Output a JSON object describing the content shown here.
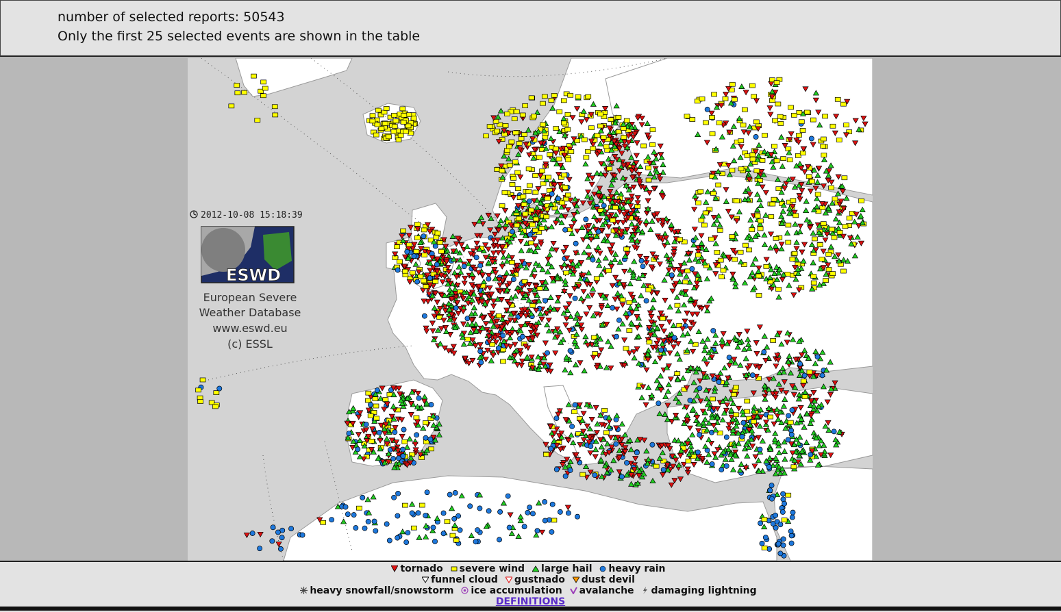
{
  "info": {
    "line1": "number of selected reports: 50543",
    "line2": "Only the first 25 selected events are shown in the table"
  },
  "map": {
    "timestamp": "2012-10-08 15:18:39",
    "logo_text": "ESWD",
    "caption": [
      "European Severe",
      "Weather Database",
      "www.eswd.eu",
      "(c) ESSL"
    ],
    "colors": {
      "sea": "#d3d3d3",
      "land": "#ffffff",
      "tornado": "#dd1111",
      "severe_wind": "#ffff00",
      "large_hail": "#22cc22",
      "heavy_rain": "#1e78dc"
    }
  },
  "legend": {
    "tornado": "tornado",
    "severe_wind": "severe wind",
    "large_hail": "large hail",
    "heavy_rain": "heavy rain",
    "funnel_cloud": "funnel cloud",
    "gustnado": "gustnado",
    "dust_devil": "dust devil",
    "heavy_snowfall": "heavy snowfall/snowstorm",
    "ice_accumulation": "ice accumulation",
    "avalanche": "avalanche",
    "damaging_lightning": "damaging lightning",
    "definitions": "DEFINITIONS"
  }
}
